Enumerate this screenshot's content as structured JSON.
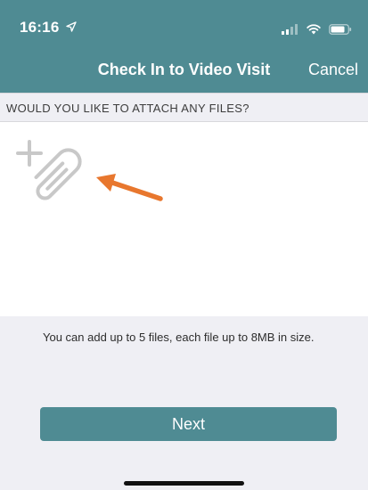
{
  "status_bar": {
    "time": "16:16",
    "icons": [
      "location-arrow-icon",
      "signal-icon",
      "wifi-icon",
      "battery-icon"
    ]
  },
  "nav": {
    "title": "Check In to Video Visit",
    "cancel_label": "Cancel"
  },
  "section": {
    "header": "WOULD YOU LIKE TO ATTACH ANY FILES?"
  },
  "attachment": {
    "icon": "add-attachment-icon",
    "pointer_icon": "orange-arrow-icon"
  },
  "footer": {
    "info": "You can add up to 5 files, each file up to 8MB in size.",
    "next_label": "Next"
  },
  "colors": {
    "primary": "#4f8b93",
    "background_gray": "#efeff4",
    "arrow_orange": "#e8772e",
    "attach_icon_gray": "#c8c8c8"
  }
}
